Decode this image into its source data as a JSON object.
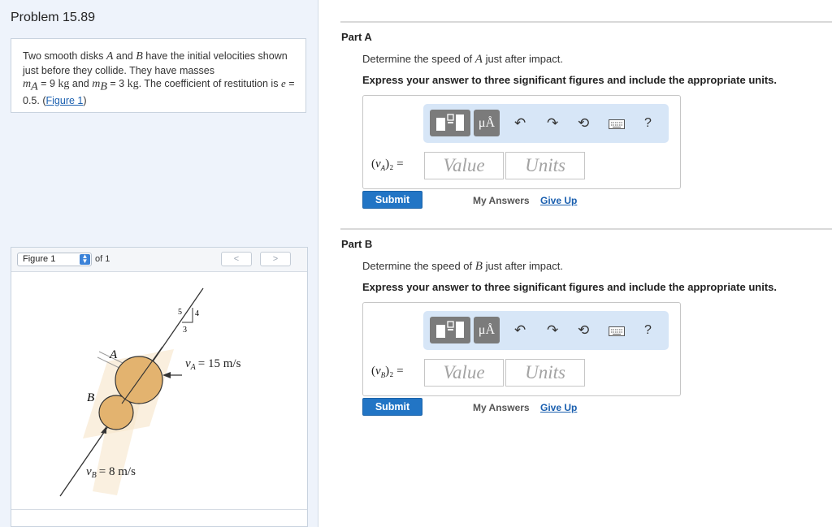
{
  "problem": {
    "title": "Problem 15.89",
    "text_intro": "Two smooth disks",
    "disk_a": "A",
    "text_and": "and",
    "disk_b": "B",
    "text_mid": "have the initial velocities shown just before they collide. They have masses",
    "ma_symbol": "m",
    "ma_sub": "A",
    "ma_eq": "= 9",
    "ma_unit": "kg",
    "and2": "and",
    "mb_symbol": "m",
    "mb_sub": "B",
    "mb_eq": "= 3",
    "mb_unit": "kg",
    "text_coeff": ". The coefficient of restitution is",
    "e_symbol": "e",
    "e_value": "= 0.5.",
    "figure_link": "Figure 1"
  },
  "figure": {
    "select_label": "Figure 1",
    "of_label": "of 1",
    "prev": "<",
    "next": ">",
    "label_a": "A",
    "label_b": "B",
    "va_text": "v",
    "va_sub": "A",
    "va_value": "= 15 m/s",
    "vb_text": "v",
    "vb_sub": "B",
    "vb_value": "= 8 m/s",
    "slope_5": "5",
    "slope_4": "4",
    "slope_3": "3"
  },
  "parts": [
    {
      "label": "Part A",
      "question_pre": "Determine the speed of",
      "question_var": "A",
      "question_post": "just after impact.",
      "instruction": "Express your answer to three significant figures and include the appropriate units.",
      "toolbar_units": "μÅ",
      "help": "?",
      "var_v": "v",
      "var_sub": "A",
      "var_tail": ")₂ =",
      "value_placeholder": "Value",
      "units_placeholder": "Units",
      "submit": "Submit",
      "my_answers": "My Answers",
      "give_up": "Give Up"
    },
    {
      "label": "Part B",
      "question_pre": "Determine the speed of",
      "question_var": "B",
      "question_post": "just after impact.",
      "instruction": "Express your answer to three significant figures and include the appropriate units.",
      "toolbar_units": "μÅ",
      "help": "?",
      "var_v": "v",
      "var_sub": "B",
      "var_tail": ")₂ =",
      "value_placeholder": "Value",
      "units_placeholder": "Units",
      "submit": "Submit",
      "my_answers": "My Answers",
      "give_up": "Give Up"
    }
  ],
  "colors": {
    "left_bg": "#eef3fb",
    "submit_bg": "#2275c5",
    "toolbar_bg": "#d7e6f7",
    "disk_fill": "#e3b36f"
  }
}
